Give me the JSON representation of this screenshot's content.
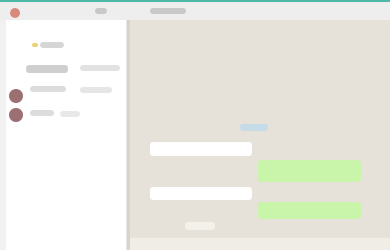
{
  "window": {
    "title": ""
  },
  "header": {
    "item_a": "",
    "item_b": ""
  },
  "sidebar": {
    "items": [
      {
        "label": ""
      },
      {
        "label": ""
      },
      {
        "label": ""
      },
      {
        "label": ""
      }
    ]
  },
  "chat": {
    "messages": [
      {
        "direction": "incoming",
        "text": ""
      },
      {
        "direction": "outgoing",
        "text": ""
      },
      {
        "direction": "incoming",
        "text": ""
      },
      {
        "direction": "outgoing",
        "text": ""
      }
    ]
  },
  "colors": {
    "accent": "#4fb7a6",
    "chat_background": "#e7e2d9",
    "outgoing_bubble": "#c8f5a9",
    "incoming_bubble": "#ffffff",
    "avatar": "#9c6f72"
  }
}
